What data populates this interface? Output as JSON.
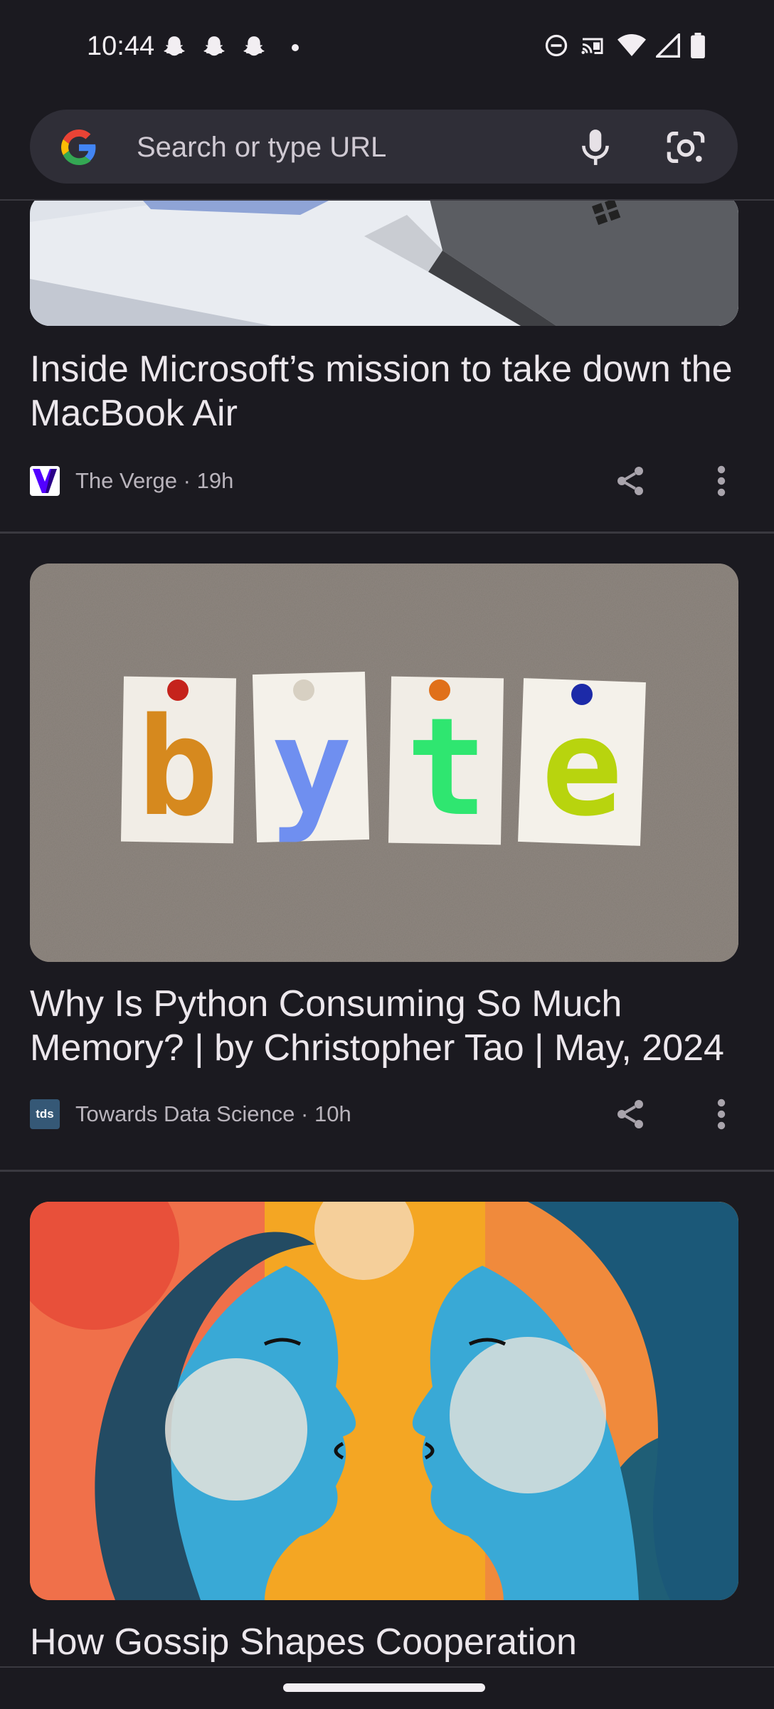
{
  "status_bar": {
    "time": "10:44",
    "left_icons": [
      "snapchat-ghost-icon",
      "snapchat-ghost-icon",
      "snapchat-ghost-icon",
      "notification-dot-icon"
    ],
    "right_icons": [
      "do-not-disturb-icon",
      "cast-icon",
      "wifi-icon",
      "signal-icon",
      "battery-icon"
    ]
  },
  "search": {
    "placeholder": "Search or type URL",
    "icons": [
      "google-g-icon",
      "microphone-icon",
      "google-lens-icon"
    ]
  },
  "feed": [
    {
      "headline": "Inside Microsoft’s mission to take down the MacBook Air",
      "publisher": "The Verge",
      "age": "19h",
      "meta": "The Verge · 19h",
      "image": "laptops-photo"
    },
    {
      "headline": "Why Is Python Consuming So Much Memory? | by Christopher Tao | May, 2024",
      "publisher": "Towards Data Science",
      "age": "10h",
      "meta": "Towards Data Science · 10h",
      "publisher_logo_text": "tds",
      "image": "byte-cards-photo",
      "image_letters": [
        "b",
        "y",
        "t",
        "e"
      ]
    },
    {
      "headline": "How Gossip Shapes Cooperation",
      "image": "two-faces-illustration"
    }
  ],
  "colors": {
    "background": "#1b1a20",
    "omnibox": "#2f2e37",
    "text_primary": "#ece7ec",
    "text_secondary": "#b9b4bc",
    "verge_purple": "#5200ff",
    "tds_blue": "#355876"
  }
}
